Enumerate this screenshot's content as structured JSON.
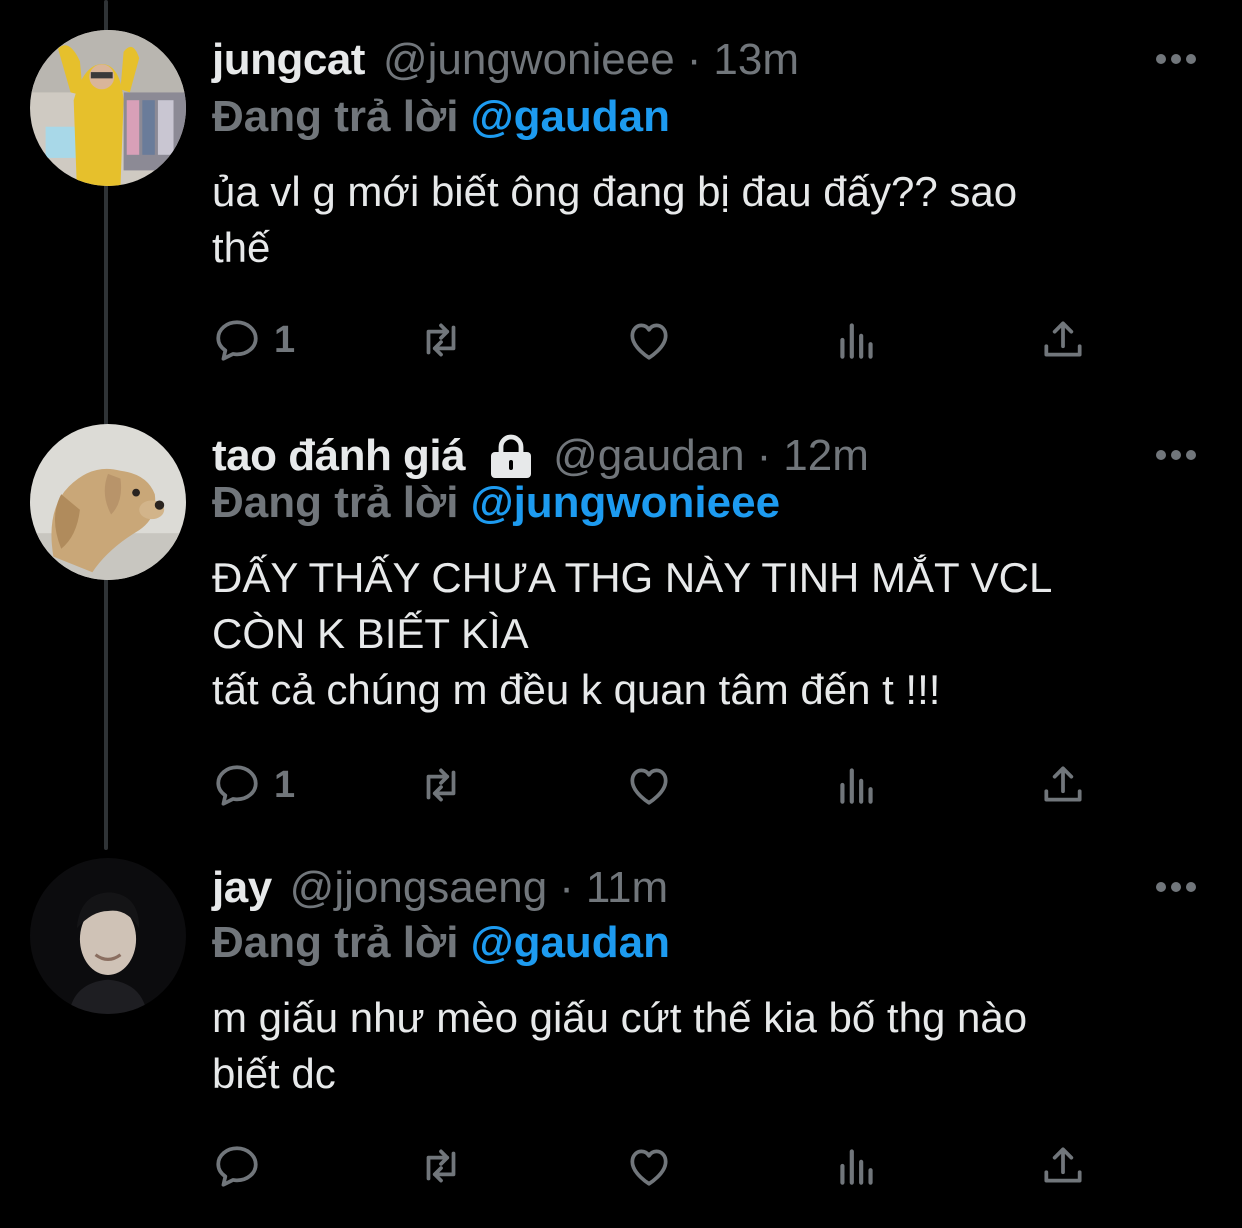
{
  "colors": {
    "background": "#000000",
    "text": "#e7e9ea",
    "muted": "#71767b",
    "link": "#1d9bf0"
  },
  "tweets": [
    {
      "display_name": "jungcat",
      "handle": "@jungwonieee",
      "separator": "·",
      "time": "13m",
      "reply_prefix": "Đang trả lời",
      "reply_to": "@gaudan",
      "text_lines": [
        "ủa vl g mới biết ông đang bị đau đấy?? sao",
        "thế"
      ],
      "reply_count": "1",
      "avatar": "avatar-yellow-hoodie",
      "locked": false
    },
    {
      "display_name": "tao đánh giá",
      "handle": "@gaudan",
      "separator": "·",
      "time": "12m",
      "reply_prefix": "Đang trả lời",
      "reply_to": "@jungwonieee",
      "text_lines": [
        "ĐẤY THẤY CHƯA THG NÀY TINH MẮT VCL",
        "CÒN K BIẾT KÌA",
        "tất cả chúng m đều k quan tâm đến t !!!"
      ],
      "reply_count": "1",
      "avatar": "avatar-dog",
      "locked": true
    },
    {
      "display_name": "jay",
      "handle": "@jjongsaeng",
      "separator": "·",
      "time": "11m",
      "reply_prefix": "Đang trả lời",
      "reply_to": "@gaudan",
      "text_lines": [
        "m giấu như mèo giấu cứt thế kia bố thg nào",
        "biết dc"
      ],
      "reply_count": "",
      "avatar": "avatar-person-dark",
      "locked": false
    }
  ],
  "icons": [
    "reply-icon",
    "retweet-icon",
    "like-icon",
    "views-icon",
    "share-icon",
    "more-icon",
    "lock-icon"
  ]
}
